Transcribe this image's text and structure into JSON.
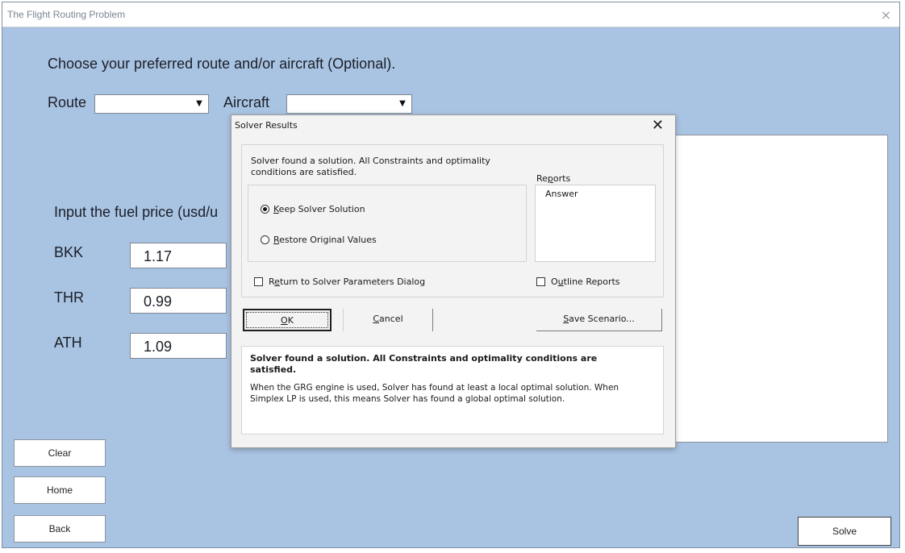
{
  "window": {
    "title": "The Flight Routing Problem",
    "close_glyph": "×"
  },
  "form": {
    "heading": "Choose your preferred route and/or aircraft (Optional).",
    "route_label": "Route",
    "route_value": "",
    "aircraft_label": "Aircraft",
    "aircraft_value": "",
    "dropdown_glyph": "▼",
    "fuel_heading": "Input the fuel price (usd/u",
    "fuel_prices": [
      {
        "code": "BKK",
        "value": "1.17"
      },
      {
        "code": "THR",
        "value": "0.99"
      },
      {
        "code": "ATH",
        "value": "1.09"
      }
    ]
  },
  "buttons": {
    "clear": "Clear",
    "home": "Home",
    "back": "Back",
    "solve": "Solve"
  },
  "dialog": {
    "title": "Solver Results",
    "close_glyph": "✕",
    "status_line1": "Solver found a solution.  All Constraints and optimality",
    "status_line2": "conditions are satisfied.",
    "options": {
      "keep_pre": "",
      "keep_key": "K",
      "keep_post": "eep Solver Solution",
      "keep_selected": true,
      "restore_pre": "",
      "restore_key": "R",
      "restore_post": "estore Original Values",
      "restore_selected": false
    },
    "reports": {
      "label_pre": "Re",
      "label_key": "p",
      "label_post": "orts",
      "items": [
        "Answer"
      ]
    },
    "return_check": {
      "pre": "R",
      "key": "e",
      "post": "turn to Solver Parameters Dialog",
      "checked": false
    },
    "outline_check": {
      "pre": "O",
      "key": "u",
      "post": "tline Reports",
      "checked": false
    },
    "ok_button": {
      "key": "O",
      "post": "K"
    },
    "cancel_button": {
      "key": "C",
      "post": "ancel"
    },
    "save_button": {
      "key": "S",
      "post": "ave Scenario..."
    },
    "message_bold": "Solver found a solution.  All Constraints and optimality conditions are satisfied.",
    "message_body": "When the GRG engine is used, Solver has found at least a local optimal solution. When Simplex LP is used, this means Solver has found a global optimal solution."
  }
}
